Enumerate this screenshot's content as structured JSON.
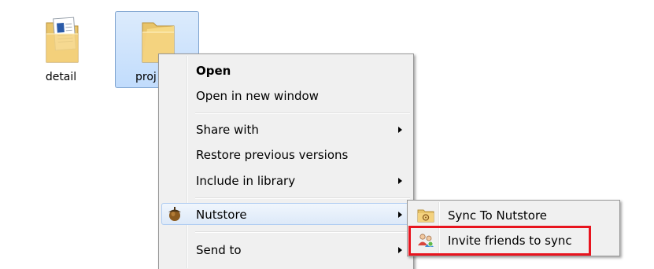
{
  "desktop": {
    "icons": [
      {
        "label": "detail",
        "icon": "document-folder-icon",
        "selected": false
      },
      {
        "label": "proj",
        "icon": "folder-icon",
        "selected": true
      }
    ]
  },
  "context_menu": {
    "items": [
      {
        "label": "Open",
        "bold": true
      },
      {
        "label": "Open in new window"
      },
      {
        "label": "Share with",
        "submenu": true
      },
      {
        "label": "Restore previous versions"
      },
      {
        "label": "Include in library",
        "submenu": true
      },
      {
        "label": "Nutstore",
        "submenu": true,
        "icon": "acorn-icon",
        "highlighted": true
      },
      {
        "label": "Send to",
        "submenu": true
      }
    ]
  },
  "submenu": {
    "items": [
      {
        "label": "Sync To Nutstore",
        "icon": "sync-folder-icon"
      },
      {
        "label": "Invite friends to sync",
        "icon": "invite-friends-icon",
        "emphasized": true
      }
    ]
  },
  "colors": {
    "menu_bg": "#f0f0f0",
    "hover_border": "#aeccf1",
    "emphasis_border": "#e8141e",
    "selection_bg": "#c1dcfc"
  }
}
